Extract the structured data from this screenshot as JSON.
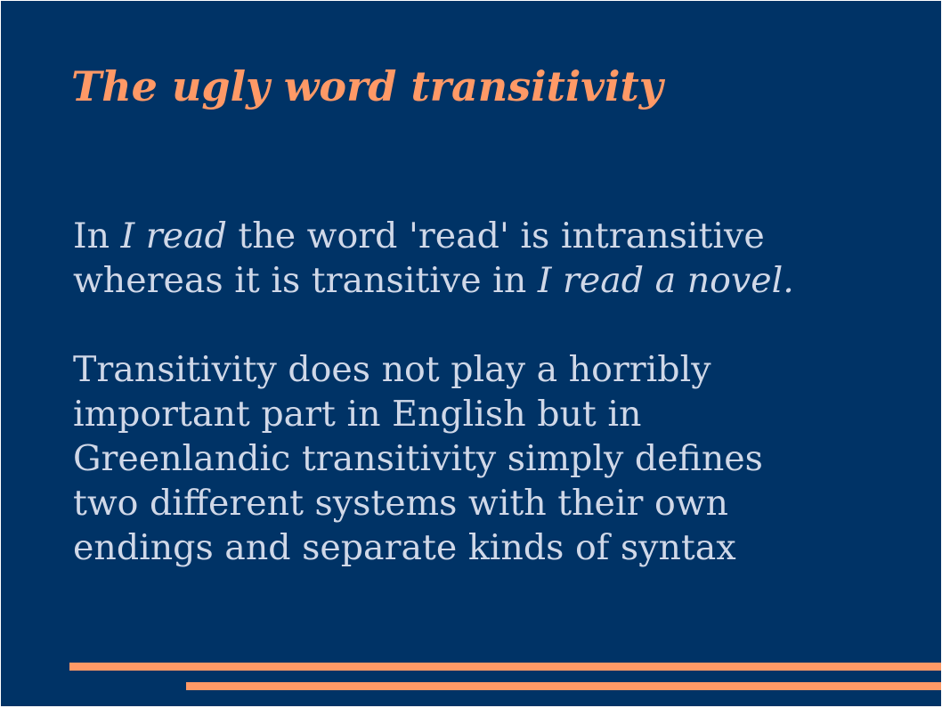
{
  "slide": {
    "title": "The ugly word transitivity",
    "paragraph1": {
      "line1": {
        "pre": "In ",
        "italic": "I read",
        "post": " the word 'read' is intransitive"
      },
      "line2": {
        "pre": "whereas it is transitive in ",
        "italic": "I read a novel."
      }
    },
    "paragraph2": {
      "lines": [
        "Transitivity does not play a horribly",
        "important part in English but in",
        "Greenlandic transitivity simply defines",
        "two different systems with their own",
        "endings and separate kinds of syntax"
      ]
    }
  },
  "colors": {
    "background": "#003366",
    "title": "#ff9966",
    "body_text": "#d0d8e8",
    "accent_rules": "#ff9966"
  }
}
